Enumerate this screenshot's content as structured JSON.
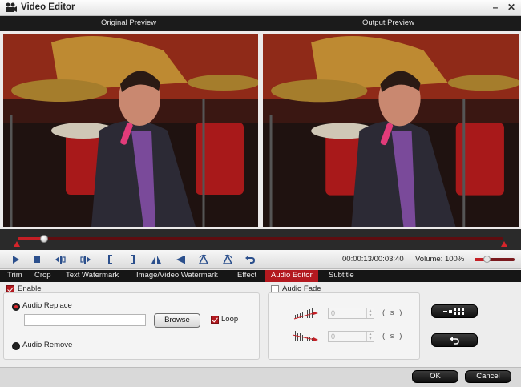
{
  "window": {
    "title": "Video Editor",
    "minimize_glyph": "–",
    "close_glyph": "✕"
  },
  "preview": {
    "original_label": "Original Preview",
    "output_label": "Output Preview"
  },
  "playback": {
    "progress_fraction": 0.055,
    "timecode": "00:00:13/00:03:40",
    "volume_label": "Volume:",
    "volume_value": "100%",
    "volume_fraction": 0.3,
    "controls": [
      "play-icon",
      "stop-icon",
      "step-back-icon",
      "step-forward-icon",
      "mark-in-icon",
      "mark-out-icon",
      "flip-horizontal-icon",
      "flip-left-icon",
      "rotate-left-icon",
      "rotate-right-icon",
      "undo-icon"
    ]
  },
  "tabs": [
    {
      "label": "Trim",
      "active": false
    },
    {
      "label": "Crop",
      "active": false
    },
    {
      "label": "Text Watermark",
      "active": false
    },
    {
      "label": "Image/Video Watermark",
      "active": false
    },
    {
      "label": "Effect",
      "active": false
    },
    {
      "label": "Audio Editor",
      "active": true
    },
    {
      "label": "Subtitle",
      "active": false
    }
  ],
  "audio_editor": {
    "enable_label": "Enable",
    "enable_checked": true,
    "replace_label": "Audio Replace",
    "replace_selected": true,
    "file_path": "",
    "browse_label": "Browse",
    "loop_label": "Loop",
    "loop_checked": true,
    "remove_label": "Audio Remove",
    "remove_selected": false,
    "fade_label": "Audio Fade",
    "fade_checked": false,
    "fade_in_value": "0",
    "fade_out_value": "0",
    "seconds_unit": "( s )"
  },
  "footer": {
    "ok_label": "OK",
    "cancel_label": "Cancel"
  },
  "colors": {
    "accent": "#b3191f",
    "dark_bar": "#1b1b1b",
    "timeline": "#2a2a2a"
  }
}
